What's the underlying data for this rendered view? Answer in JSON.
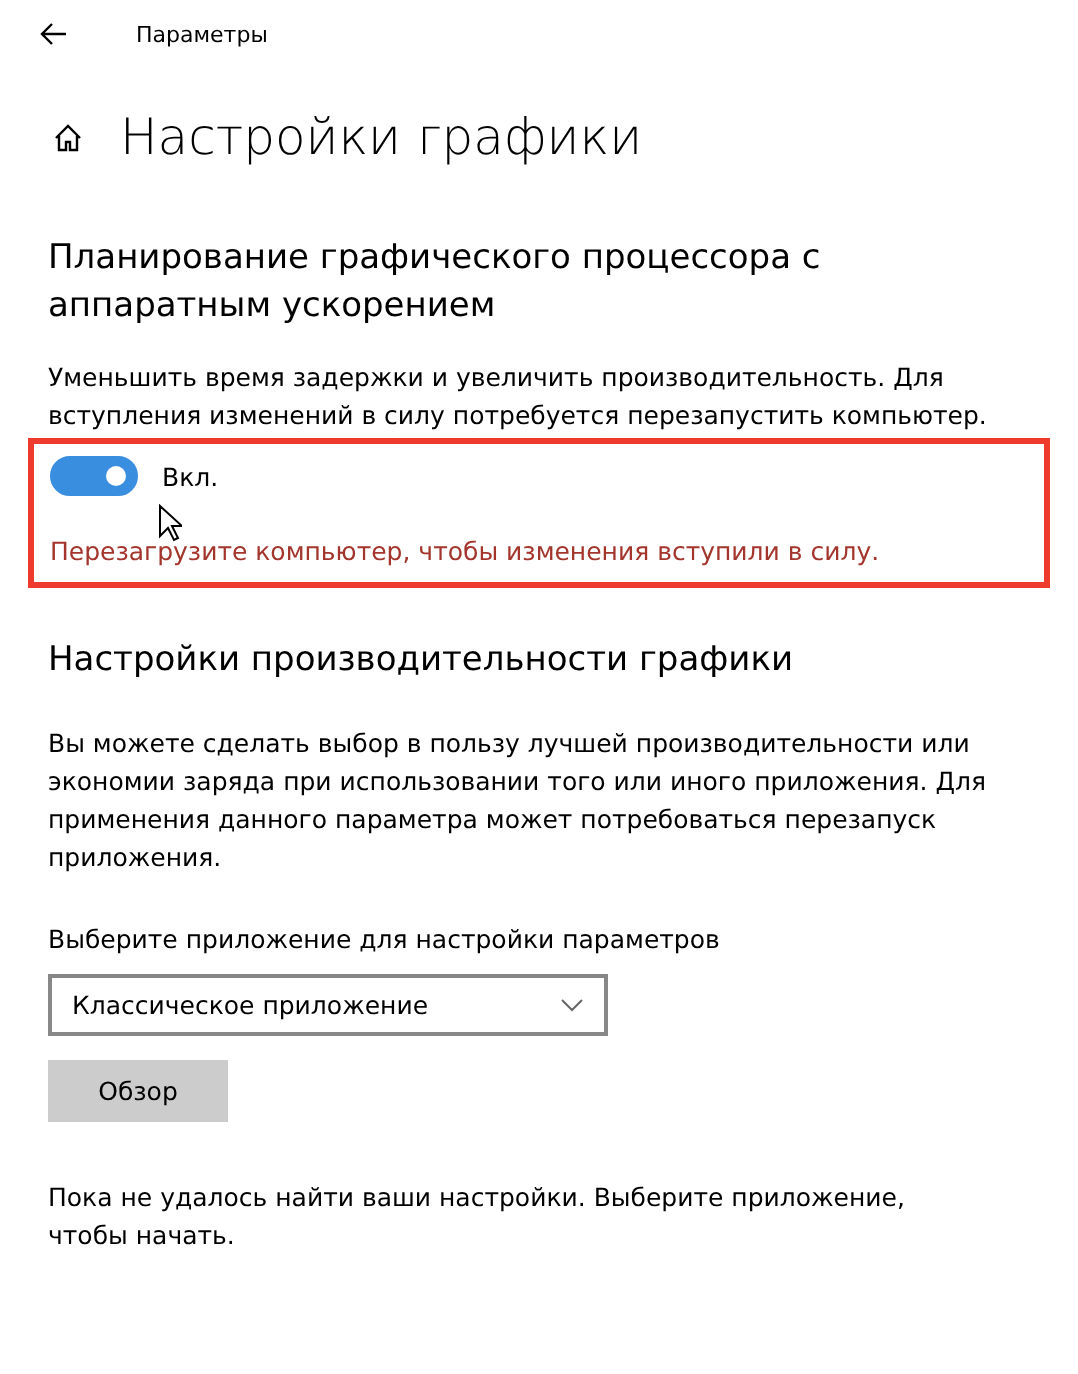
{
  "window": {
    "title": "Параметры"
  },
  "page": {
    "title": "Настройки графики"
  },
  "gpu_scheduling": {
    "heading": "Планирование графического процессора с аппаратным ускорением",
    "description": "Уменьшить время задержки и увеличить производительность. Для вступления изменений в силу потребуется перезапустить компьютер.",
    "toggle": {
      "on": true,
      "label": "Вкл."
    },
    "warning": "Перезагрузите компьютер, чтобы изменения вступили в силу.",
    "highlighted": true
  },
  "performance": {
    "heading": "Настройки производительности графики",
    "description": "Вы можете сделать выбор в пользу лучшей производительности или экономии заряда при использовании того или иного приложения. Для применения данного параметра может потребоваться перезапуск приложения.",
    "select_label": "Выберите приложение для настройки параметров",
    "select": {
      "value": "Классическое приложение"
    },
    "browse_button": "Обзор",
    "empty_message": "Пока не удалось найти ваши настройки. Выберите приложение, чтобы начать."
  }
}
